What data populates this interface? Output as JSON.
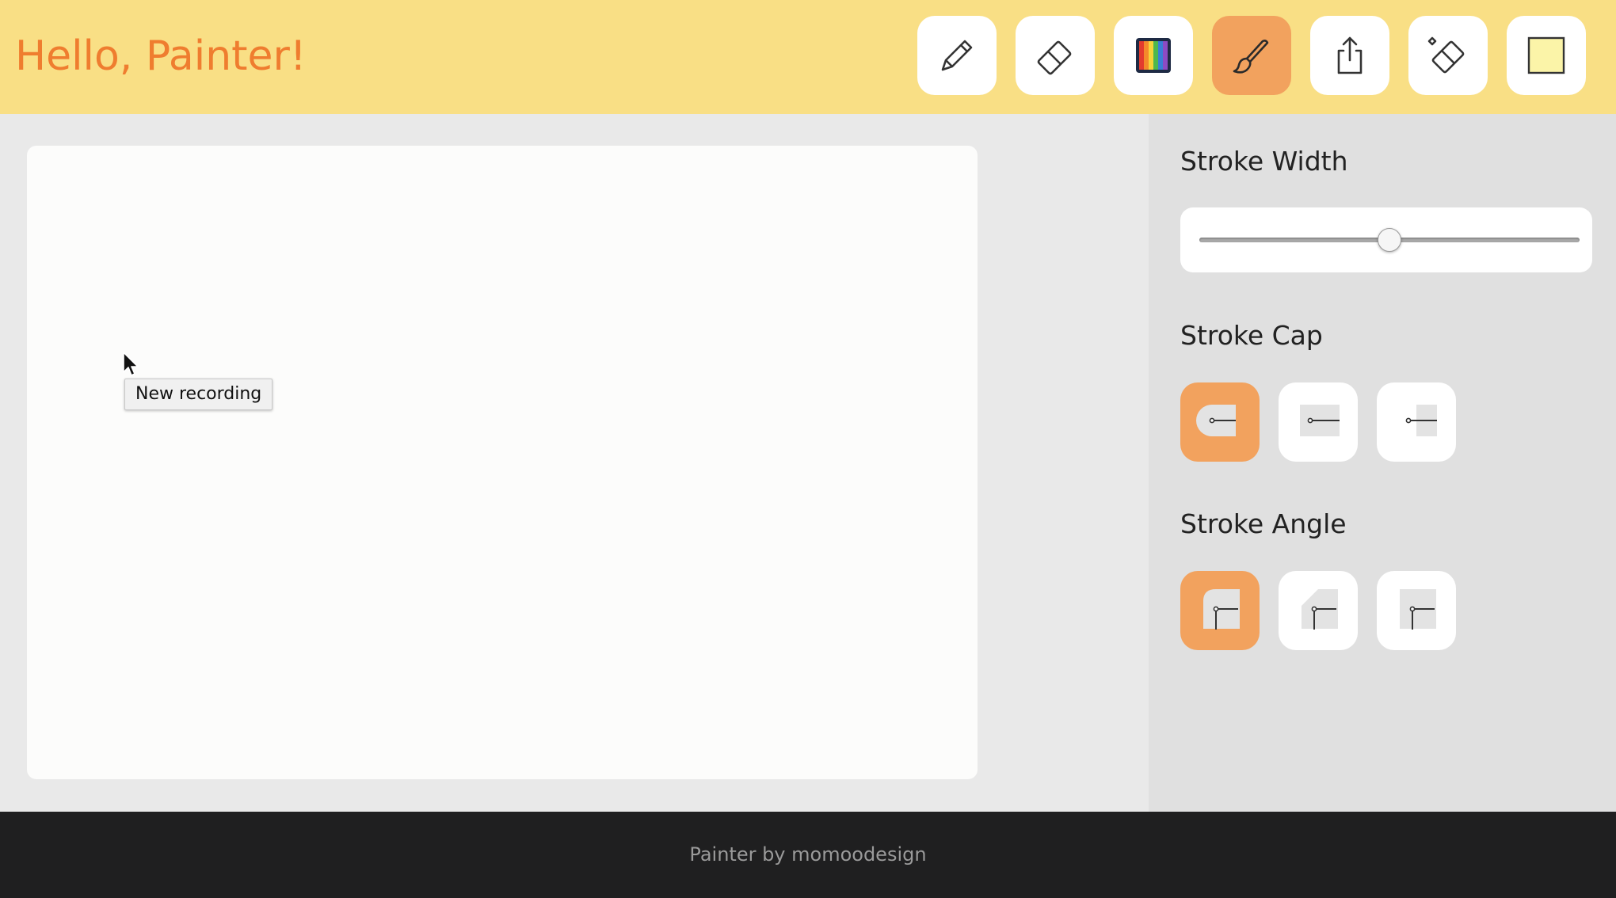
{
  "header": {
    "title": "Hello, Painter!",
    "tools": [
      {
        "name": "pencil",
        "icon": "pencil-icon",
        "active": false
      },
      {
        "name": "eraser",
        "icon": "eraser-icon",
        "active": false
      },
      {
        "name": "color",
        "icon": "rainbow-palette-icon",
        "active": false
      },
      {
        "name": "brush",
        "icon": "brush-icon",
        "active": true
      },
      {
        "name": "export",
        "icon": "share-icon",
        "active": false
      },
      {
        "name": "clear",
        "icon": "eraser-sparkle-icon",
        "active": false
      },
      {
        "name": "background",
        "icon": "color-swatch-icon",
        "active": false
      }
    ]
  },
  "tooltip": {
    "text": "New recording"
  },
  "panel": {
    "stroke_width": {
      "title": "Stroke Width",
      "value_fraction": 0.5
    },
    "stroke_cap": {
      "title": "Stroke Cap",
      "options": [
        "round",
        "butt",
        "square"
      ],
      "selected": "round"
    },
    "stroke_angle": {
      "title": "Stroke Angle",
      "options": [
        "round",
        "bevel",
        "miter"
      ],
      "selected": "round"
    }
  },
  "footer": {
    "text": "Painter by momoodesign"
  },
  "colors": {
    "header_bg": "#f9df85",
    "accent": "#f2a25e",
    "title_color": "#ef7d2f",
    "background_swatch": "#fbf4a8",
    "footer_bg": "#1f1f20"
  }
}
